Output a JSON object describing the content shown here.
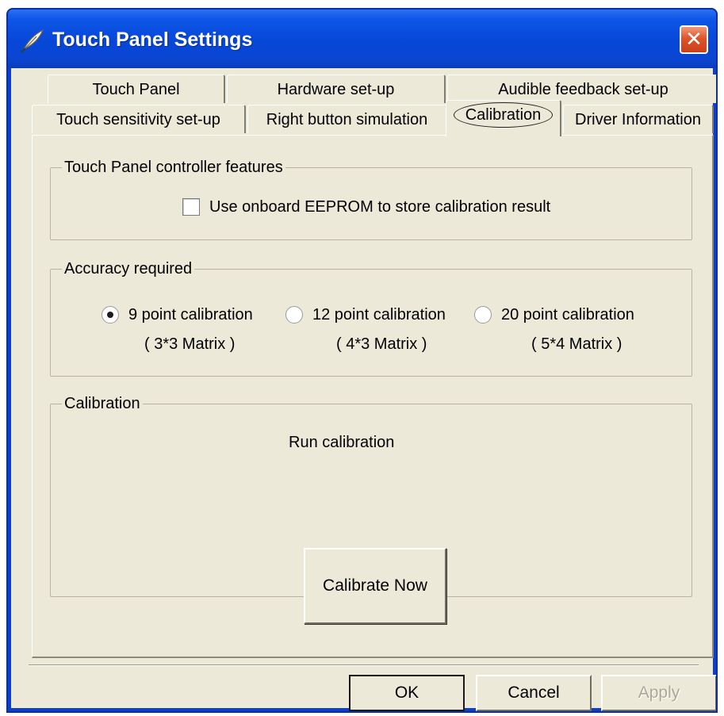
{
  "window": {
    "title": "Touch Panel Settings",
    "close_glyph": "✕",
    "icon": "feather-pen-icon"
  },
  "tabs": {
    "row_back": [
      {
        "label": "Touch Panel"
      },
      {
        "label": "Hardware set-up"
      },
      {
        "label": "Audible feedback set-up"
      }
    ],
    "row_front": [
      {
        "label": "Touch sensitivity set-up"
      },
      {
        "label": "Right button simulation"
      },
      {
        "label": "Calibration",
        "selected": true
      },
      {
        "label": "Driver Information"
      }
    ]
  },
  "controller_group": {
    "legend": "Touch Panel controller features",
    "eeprom_checkbox": {
      "label": "Use onboard EEPROM to store calibration result",
      "checked": false
    }
  },
  "accuracy_group": {
    "legend": "Accuracy required",
    "options": [
      {
        "label": "9 point calibration",
        "sub": "( 3*3 Matrix )",
        "selected": true
      },
      {
        "label": "12 point calibration",
        "sub": "( 4*3 Matrix )",
        "selected": false
      },
      {
        "label": "20 point calibration",
        "sub": "( 5*4 Matrix )",
        "selected": false
      }
    ]
  },
  "calibration_group": {
    "legend": "Calibration",
    "run_label": "Run calibration",
    "calibrate_button": "Calibrate Now"
  },
  "footer": {
    "ok": "OK",
    "cancel": "Cancel",
    "apply": "Apply"
  },
  "colors": {
    "titlebar": "#0a45d2",
    "client_bg": "#ece9d8",
    "close_button": "#e0532a",
    "disabled_text": "#aca899"
  }
}
